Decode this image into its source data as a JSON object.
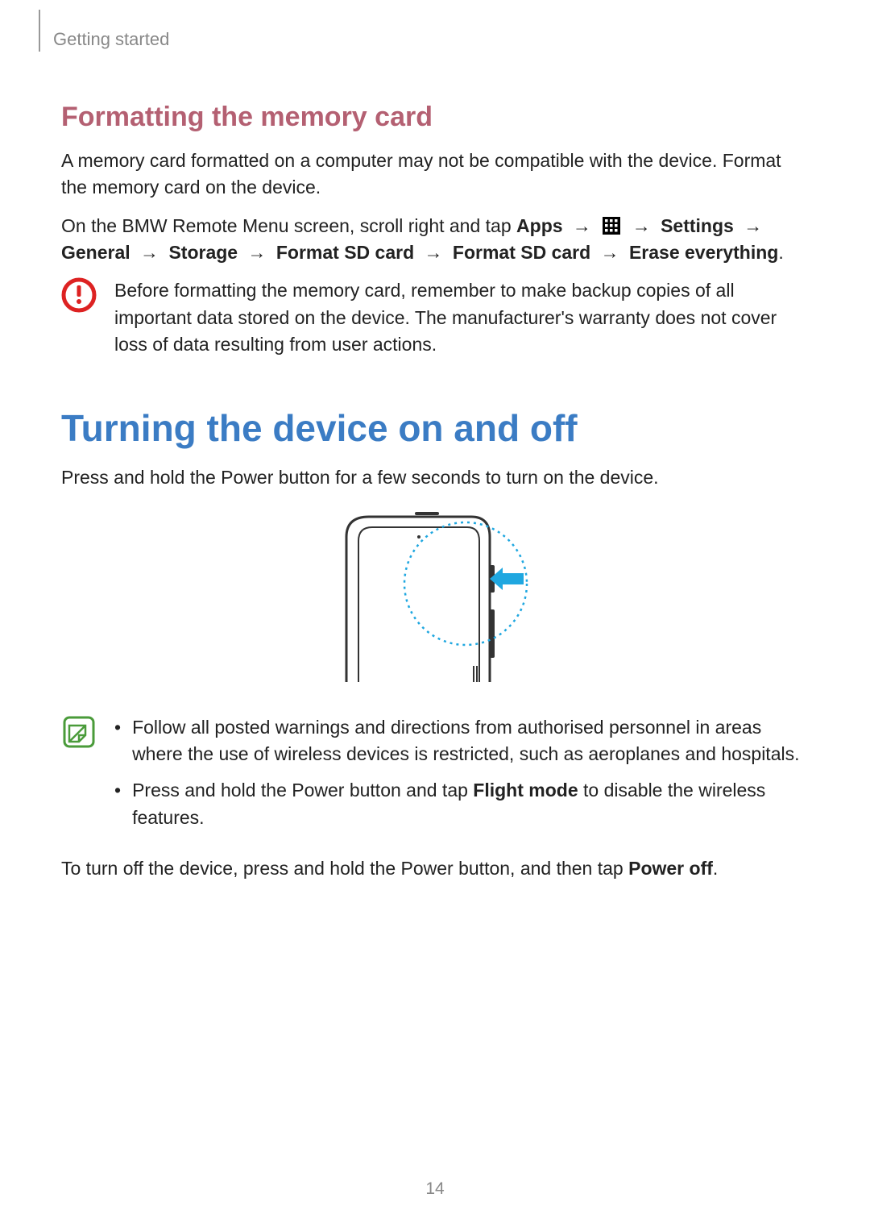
{
  "breadcrumb": "Getting started",
  "section1": {
    "heading": "Formatting the memory card",
    "p1": "A memory card formatted on a computer may not be compatible with the device. Format the memory card on the device.",
    "p2": {
      "pre": "On the BMW Remote Menu screen, scroll right and tap ",
      "apps": "Apps",
      "arrow": "→",
      "settings": "Settings",
      "general": "General",
      "storage": "Storage",
      "format1": "Format SD card",
      "format2": "Format SD card",
      "erase": "Erase everything",
      "period": "."
    },
    "callout": "Before formatting the memory card, remember to make backup copies of all important data stored on the device. The manufacturer's warranty does not cover loss of data resulting from user actions."
  },
  "section2": {
    "heading": "Turning the device on and off",
    "p1": "Press and hold the Power button for a few seconds to turn on the device.",
    "tips": [
      {
        "pre": "Follow all posted warnings and directions from authorised personnel in areas where the use of wireless devices is restricted, such as aeroplanes and hospitals.",
        "bold": "",
        "post": ""
      },
      {
        "pre": "Press and hold the Power button and tap ",
        "bold": "Flight mode",
        "post": " to disable the wireless features."
      }
    ],
    "p2": {
      "pre": "To turn off the device, press and hold the Power button, and then tap ",
      "bold": "Power off",
      "post": "."
    }
  },
  "page_number": "14",
  "bullet": "•"
}
